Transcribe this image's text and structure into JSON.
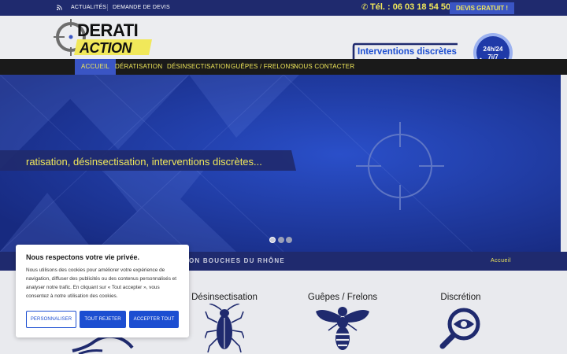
{
  "topbar": {
    "rss_icon": "rss-icon",
    "links": [
      "ACTUALITÉS",
      "DEMANDE DE DEVIS"
    ],
    "phone_icon": "phone-icon",
    "phone": "Tél. : 06 03 18 54 50",
    "devis_button": "DEVIS GRATUIT !"
  },
  "header": {
    "logo_line1": "DERATI",
    "logo_line2": "ACTION",
    "interventions_label": "Interventions discrètes !",
    "badge_line1": "24h/24",
    "badge_line2": "7j/7"
  },
  "nav": {
    "items": [
      "ACCUEIL",
      "DÉRATISATION",
      "DÉSINSECTISATION",
      "GUÊPES / FRELONS",
      "NOUS CONTACTER"
    ]
  },
  "hero": {
    "tagline": "ratisation, désinsectisation, interventions discrètes...",
    "slides": 3,
    "active_slide": 1
  },
  "band": {
    "location": "ON BOUCHES DU RHÔNE",
    "breadcrumb": "Accueil"
  },
  "services": [
    {
      "title": "Désinsectisation",
      "icon": "cockroach-icon"
    },
    {
      "title": "Guêpes / Frelons",
      "icon": "wasp-icon"
    },
    {
      "title": "Discrétion",
      "icon": "magnifier-eye-icon"
    }
  ],
  "cookie": {
    "title": "Nous respectons votre vie privée.",
    "text": "Nous utilisons des cookies pour améliorer votre expérience de navigation, diffuser des publicités ou des contenus personnalisés et analyser notre trafic. En cliquant sur « Tout accepter », vous consentez à notre utilisation des cookies.",
    "buttons": [
      "PERSONNALISER",
      "TOUT REJETER",
      "ACCEPTER TOUT"
    ]
  },
  "colors": {
    "navy": "#1f2a6e",
    "yellow": "#f1e85a",
    "blue": "#3a55c4",
    "cookie_blue": "#1c4ed1"
  }
}
